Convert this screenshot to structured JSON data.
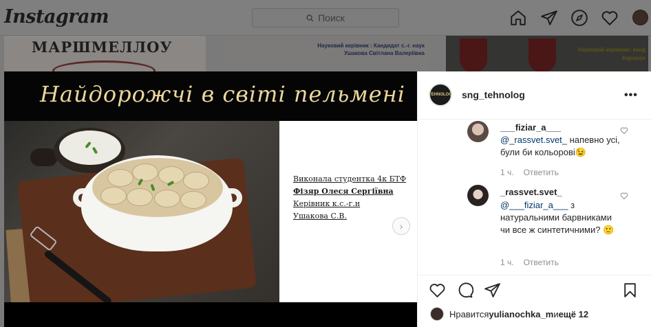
{
  "nav": {
    "logo": "Instagram",
    "search_placeholder": "Поиск",
    "icons": [
      "home-icon",
      "direct-icon",
      "explore-icon",
      "activity-icon",
      "profile-avatar"
    ]
  },
  "feed_background": {
    "post1_title": "МАРШМЕЛЛОУ",
    "post2_line1": "Науковий керівник : Кандидат с.-г. наук",
    "post2_line2": "Ушакова Світлана Валеріївна",
    "post3_line1": "Науковий керівник: канд",
    "post3_line2": "Карашук"
  },
  "post": {
    "banner_title": "Найдорожчі в світі пельмені",
    "slide_text": [
      "Виконала студентка 4к БТФ",
      "Фізяр Олеся Сергіївна",
      "Керівник  к.с.-г.н",
      "Ушакова С.В."
    ],
    "username": "sng_tehnolog",
    "more_label": "•••",
    "avatar_label": "TEHNOLOG"
  },
  "comments": [
    {
      "user": "___fiziar_a___",
      "mention": "@_rassvet.svet_",
      "text": " напевно усі, були би кольорові😉",
      "time": "1 ч.",
      "reply": "Ответить"
    },
    {
      "user": "_rassvet.svet_",
      "mention": "@___fiziar_a___",
      "text": " з натуральними барвниками чи все ж синтетичними? 🙂",
      "time": "1 ч.",
      "reply": "Ответить"
    }
  ],
  "likes": {
    "prefix": "Нравится ",
    "user": "yulianochka_m",
    "and": " и ",
    "more": "ещё 12"
  }
}
